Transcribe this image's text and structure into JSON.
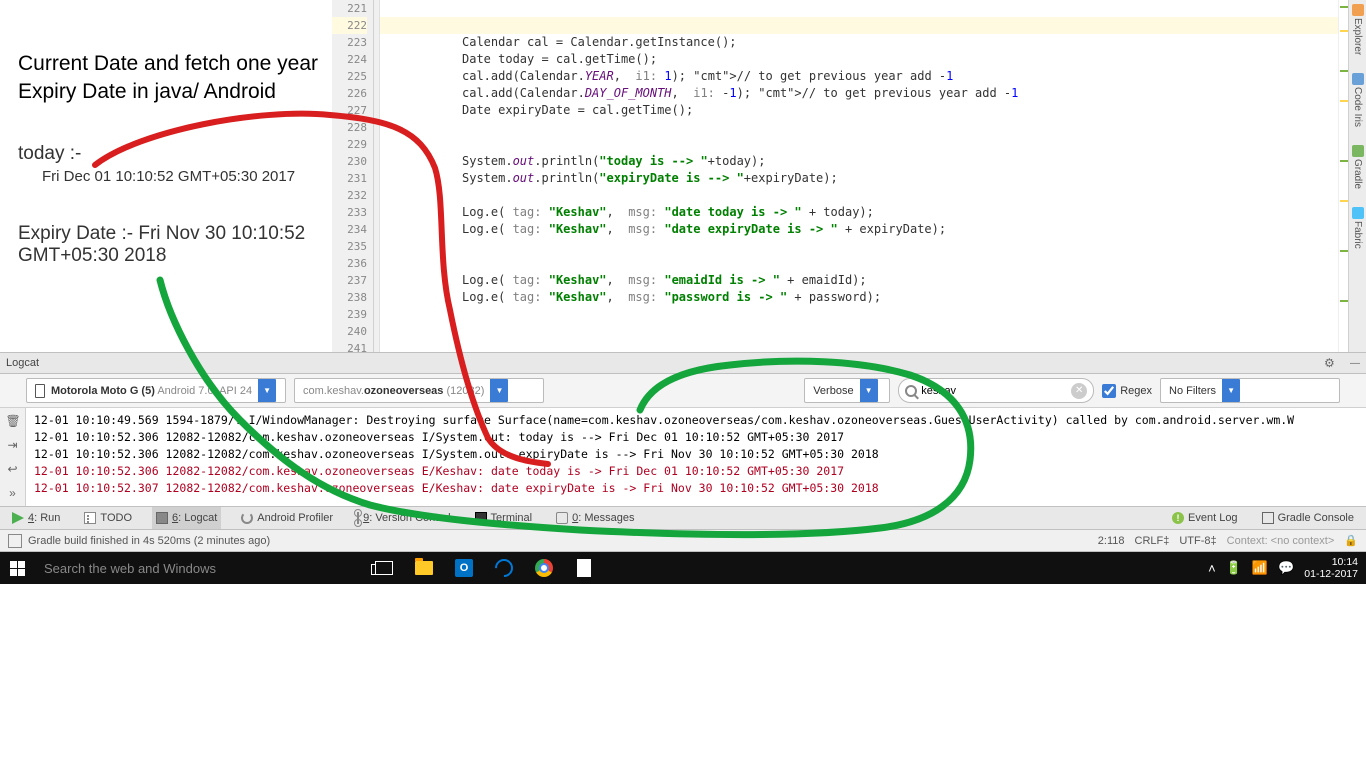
{
  "annot": {
    "title": "Current Date and fetch one year Expiry Date in java/ Android",
    "today_label": "today :-",
    "today_value": "Fri Dec 01 10:10:52 GMT+05:30 2017",
    "expiry_label": "Expiry Date :-",
    "expiry_value": "Fri Nov 30 10:10:52 GMT+05:30 2018"
  },
  "gutter": {
    "start": 221,
    "end": 241,
    "highlight": 222
  },
  "code": [
    "",
    "",
    "Calendar cal = Calendar.getInstance();",
    "Date today = cal.getTime();",
    "cal.add(Calendar.YEAR,  i1: 1); // to get previous year add -1",
    "cal.add(Calendar.DAY_OF_MONTH,  i1: -1); // to get previous year add -1",
    "Date expiryDate = cal.getTime();",
    "",
    "",
    "System.out.println(\"today is --> \"+today);",
    "System.out.println(\"expiryDate is --> \"+expiryDate);",
    "",
    "Log.e( tag: \"Keshav\",  msg: \"date today is -> \" + today);",
    "Log.e( tag: \"Keshav\",  msg: \"date expiryDate is -> \" + expiryDate);",
    "",
    "",
    "Log.e( tag: \"Keshav\",  msg: \"emaidId is -> \" + emaidId);",
    "Log.e( tag: \"Keshav\",  msg: \"password is -> \" + password);",
    "",
    "",
    ""
  ],
  "right_rail": [
    "Explorer",
    "Code Iris",
    "Gradle",
    "Fabric"
  ],
  "logcat": {
    "title": "Logcat",
    "device": {
      "name": "Motorola Moto G (5)",
      "meta": "Android 7.0, API 24"
    },
    "package": {
      "name": "com.keshav.ozoneoverseas",
      "pid": "(12082)"
    },
    "level": "Verbose",
    "search": "keshav",
    "regex_label": "Regex",
    "filter": "No Filters",
    "lines": [
      {
        "err": false,
        "text": "12-01 10:10:49.569 1594-1879/? I/WindowManager: Destroying surface Surface(name=com.keshav.ozoneoverseas/com.keshav.ozoneoverseas.GuestUserActivity) called by com.android.server.wm.W"
      },
      {
        "err": false,
        "text": "12-01 10:10:52.306 12082-12082/com.keshav.ozoneoverseas I/System.out: today is --> Fri Dec 01 10:10:52 GMT+05:30 2017"
      },
      {
        "err": false,
        "text": "12-01 10:10:52.306 12082-12082/com.keshav.ozoneoverseas I/System.out: expiryDate is --> Fri Nov 30 10:10:52 GMT+05:30 2018"
      },
      {
        "err": true,
        "text": "12-01 10:10:52.306 12082-12082/com.keshav.ozoneoverseas E/Keshav: date today is -> Fri Dec 01 10:10:52 GMT+05:30 2017"
      },
      {
        "err": true,
        "text": "12-01 10:10:52.307 12082-12082/com.keshav.ozoneoverseas E/Keshav: date expiryDate is -> Fri Nov 30 10:10:52 GMT+05:30 2018"
      }
    ]
  },
  "bottom_tabs": {
    "run": "4: Run",
    "todo": "TODO",
    "logcat": "6: Logcat",
    "profiler": "Android Profiler",
    "vcs": "9: Version Control",
    "terminal": "Terminal",
    "messages": "0: Messages",
    "event_log": "Event Log",
    "gradle_console": "Gradle Console"
  },
  "status": {
    "left": "Gradle build finished in 4s 520ms (2 minutes ago)",
    "pos": "2:118",
    "eol": "CRLF",
    "enc": "UTF-8",
    "context": "Context: <no context>"
  },
  "taskbar": {
    "search_placeholder": "Search the web and Windows",
    "outlook_letter": "O",
    "time": "10:14",
    "date": "01-12-2017"
  }
}
